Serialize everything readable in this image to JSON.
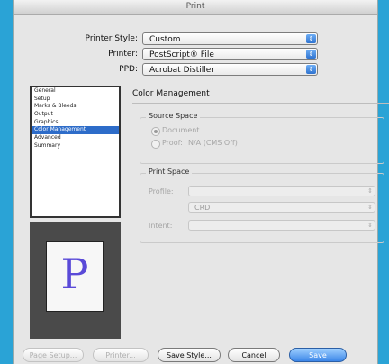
{
  "window": {
    "title": "Print"
  },
  "top": {
    "printer_style_label": "Printer Style:",
    "printer_style_value": "Custom",
    "printer_label": "Printer:",
    "printer_value": "PostScript® File",
    "ppd_label": "PPD:",
    "ppd_value": "Acrobat Distiller"
  },
  "sidebar": {
    "items": [
      "General",
      "Setup",
      "Marks & Bleeds",
      "Output",
      "Graphics",
      "Color Management",
      "Advanced",
      "Summary"
    ],
    "selected": "Color Management"
  },
  "preview": {
    "letter": "P"
  },
  "panel": {
    "title": "Color Management",
    "source_space": {
      "title": "Source Space",
      "option_document": "Document",
      "option_proof": "Proof:",
      "proof_value": "N/A (CMS Off)"
    },
    "print_space": {
      "title": "Print Space",
      "profile_label": "Profile:",
      "profile_value": "",
      "crd_value": "CRD",
      "intent_label": "Intent:",
      "intent_value": ""
    }
  },
  "buttons": {
    "page_setup": "Page Setup...",
    "printer": "Printer...",
    "save_style": "Save Style...",
    "cancel": "Cancel",
    "save": "Save"
  },
  "icons": {
    "popup_arrow": "updown-arrows-icon"
  },
  "colors": {
    "accent": "#2d6cc9",
    "desktop": "#2aa3d6"
  }
}
